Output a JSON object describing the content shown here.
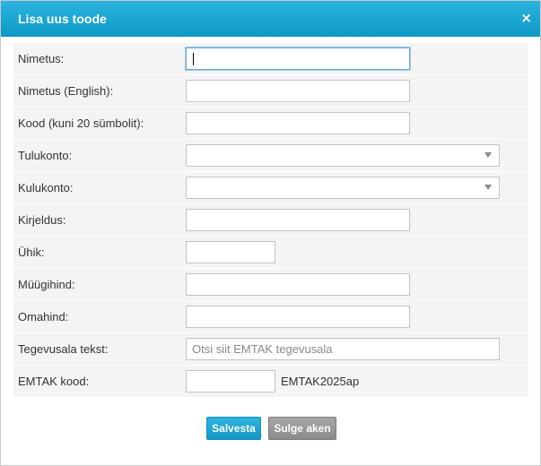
{
  "dialog": {
    "title": "Lisa uus toode",
    "close_glyph": "×",
    "colors": {
      "header": "#1aa6d3",
      "save": "#1da3d2",
      "close": "#999999",
      "row_bg": "#f4f4f4"
    }
  },
  "form": {
    "rows": [
      {
        "label": "Nimetus:",
        "value": ""
      },
      {
        "label": "Nimetus (English):",
        "value": ""
      },
      {
        "label": "Kood (kuni 20 sümbolit):",
        "value": ""
      },
      {
        "label": "Tulukonto:",
        "value": ""
      },
      {
        "label": "Kulukonto:",
        "value": ""
      },
      {
        "label": "Kirjeldus:",
        "value": ""
      },
      {
        "label": "Ühik:",
        "value": ""
      },
      {
        "label": "Müügihind:",
        "value": ""
      },
      {
        "label": "Omahind:",
        "value": ""
      },
      {
        "label": "Tegevusala tekst:",
        "value": "",
        "placeholder": "Otsi siit EMTAK tegevusala"
      },
      {
        "label": "EMTAK kood:",
        "value": "",
        "suffix": "EMTAK2025ap"
      }
    ]
  },
  "buttons": {
    "save_label": "Salvesta",
    "close_label": "Sulge aken"
  },
  "icons": {
    "close": "close-icon",
    "dropdown": "chevron-down-icon"
  }
}
